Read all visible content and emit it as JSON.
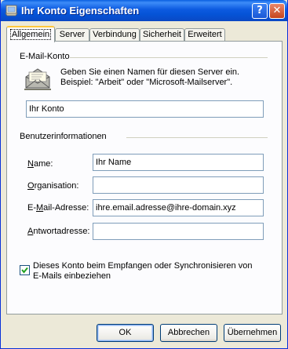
{
  "window": {
    "title": "Ihr Konto Eigenschaften",
    "help_glyph": "?",
    "close_glyph": "✕"
  },
  "tabs": [
    {
      "label": "Allgemein",
      "active": true
    },
    {
      "label": "Server",
      "active": false
    },
    {
      "label": "Verbindung",
      "active": false
    },
    {
      "label": "Sicherheit",
      "active": false
    },
    {
      "label": "Erweitert",
      "active": false
    }
  ],
  "email_account": {
    "group_label": "E-Mail-Konto",
    "description": "Geben Sie einen Namen für diesen Server ein. Beispiel: \"Arbeit\" oder \"Microsoft-Mailserver\".",
    "account_name": "Ihr Konto",
    "icon": "mail-server-icon"
  },
  "user_info": {
    "group_label": "Benutzerinformationen",
    "name_label": "Name:",
    "name_value": "Ihr Name",
    "organisation_label": "Organisation:",
    "organisation_value": "",
    "email_label": "E-Mail-Adresse:",
    "email_value": "ihre.email.adresse@ihre-domain.xyz",
    "reply_label": "Antwortadresse:",
    "reply_value": ""
  },
  "checkbox": {
    "label": "Dieses Konto beim Empfangen oder Synchronisieren von E-Mails einbeziehen",
    "checked": true
  },
  "buttons": {
    "ok": "OK",
    "cancel": "Abbrechen",
    "apply": "Übernehmen"
  },
  "colors": {
    "titlebar": "#0a5fe0",
    "window_bg": "#ece9d8",
    "panel_bg": "#fcfcfe",
    "active_tab_accent": "#ffc83c",
    "check_green": "#21a121"
  }
}
